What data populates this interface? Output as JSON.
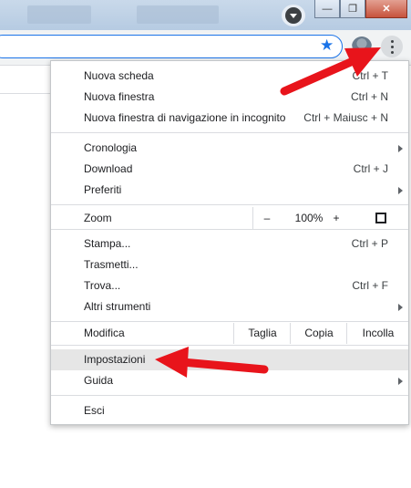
{
  "titlebar": {
    "minimize": "—",
    "restore": "❐",
    "close": "✕"
  },
  "toolbar": {
    "bookmark_icon": "★",
    "avatar_icon": "avatar",
    "menu_icon": "more-vert"
  },
  "menu": {
    "new_tab": {
      "label": "Nuova scheda",
      "shortcut": "Ctrl + T"
    },
    "new_window": {
      "label": "Nuova finestra",
      "shortcut": "Ctrl + N"
    },
    "incognito": {
      "label": "Nuova finestra di navigazione in incognito",
      "shortcut": "Ctrl + Maiusc + N"
    },
    "history": {
      "label": "Cronologia"
    },
    "downloads": {
      "label": "Download",
      "shortcut": "Ctrl + J"
    },
    "bookmarks": {
      "label": "Preferiti"
    },
    "zoom": {
      "label": "Zoom",
      "minus": "–",
      "value": "100%",
      "plus": "+"
    },
    "print": {
      "label": "Stampa...",
      "shortcut": "Ctrl + P"
    },
    "cast": {
      "label": "Trasmetti..."
    },
    "find": {
      "label": "Trova...",
      "shortcut": "Ctrl + F"
    },
    "more_tools": {
      "label": "Altri strumenti"
    },
    "edit": {
      "label": "Modifica",
      "cut": "Taglia",
      "copy": "Copia",
      "paste": "Incolla"
    },
    "settings": {
      "label": "Impostazioni"
    },
    "help": {
      "label": "Guida"
    },
    "exit": {
      "label": "Esci"
    }
  },
  "colors": {
    "accent": "#1a73e8",
    "annotation_arrow": "#e8141b",
    "highlight": "#e6e6e6"
  }
}
